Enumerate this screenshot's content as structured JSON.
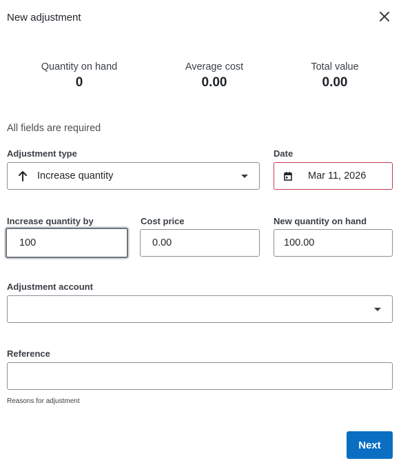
{
  "dialog": {
    "title": "New adjustment"
  },
  "summary": {
    "quantity_on_hand": {
      "label": "Quantity on hand",
      "value": "0"
    },
    "average_cost": {
      "label": "Average cost",
      "value": "0.00"
    },
    "total_value": {
      "label": "Total value",
      "value": "0.00"
    }
  },
  "form": {
    "required_note": "All fields are required",
    "adjustment_type": {
      "label": "Adjustment type",
      "value": "Increase quantity",
      "icon": "arrow-up-icon"
    },
    "date": {
      "label": "Date",
      "value": "Mar 11, 2026",
      "icon": "calendar-icon"
    },
    "increase_quantity": {
      "label": "Increase quantity by",
      "value": "100"
    },
    "cost_price": {
      "label": "Cost price",
      "value": "0.00"
    },
    "new_quantity": {
      "label": "New quantity on hand",
      "value": "100.00"
    },
    "adjustment_account": {
      "label": "Adjustment account",
      "value": ""
    },
    "reference": {
      "label": "Reference",
      "value": "",
      "hint": "Reasons for adjustment"
    }
  },
  "actions": {
    "next_label": "Next"
  },
  "colors": {
    "primary": "#0a6fc2",
    "error_border": "#c33a4a"
  }
}
